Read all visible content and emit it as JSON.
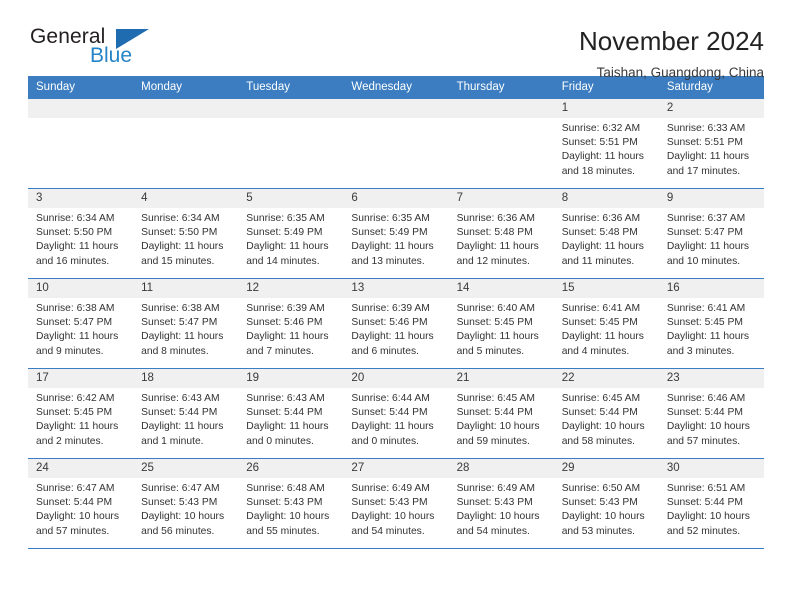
{
  "logo": {
    "word_top": "General",
    "word_bottom": "Blue",
    "triangle_color": "#1f6cb0",
    "blue_text_color": "#2585c7"
  },
  "header": {
    "title": "November 2024",
    "subtitle": "Taishan, Guangdong, China"
  },
  "theme": {
    "header_blue": "#3b7dc0",
    "daynum_band": "#f0f0f0",
    "text": "#333333"
  },
  "calendar": {
    "weekday_headers": [
      "Sunday",
      "Monday",
      "Tuesday",
      "Wednesday",
      "Thursday",
      "Friday",
      "Saturday"
    ],
    "weeks": [
      [
        {
          "day": "",
          "sunrise": "",
          "sunset": "",
          "daylight_l1": "",
          "daylight_l2": "",
          "empty": true
        },
        {
          "day": "",
          "sunrise": "",
          "sunset": "",
          "daylight_l1": "",
          "daylight_l2": "",
          "empty": true
        },
        {
          "day": "",
          "sunrise": "",
          "sunset": "",
          "daylight_l1": "",
          "daylight_l2": "",
          "empty": true
        },
        {
          "day": "",
          "sunrise": "",
          "sunset": "",
          "daylight_l1": "",
          "daylight_l2": "",
          "empty": true
        },
        {
          "day": "",
          "sunrise": "",
          "sunset": "",
          "daylight_l1": "",
          "daylight_l2": "",
          "empty": true
        },
        {
          "day": "1",
          "sunrise": "Sunrise: 6:32 AM",
          "sunset": "Sunset: 5:51 PM",
          "daylight_l1": "Daylight: 11 hours",
          "daylight_l2": "and 18 minutes."
        },
        {
          "day": "2",
          "sunrise": "Sunrise: 6:33 AM",
          "sunset": "Sunset: 5:51 PM",
          "daylight_l1": "Daylight: 11 hours",
          "daylight_l2": "and 17 minutes."
        }
      ],
      [
        {
          "day": "3",
          "sunrise": "Sunrise: 6:34 AM",
          "sunset": "Sunset: 5:50 PM",
          "daylight_l1": "Daylight: 11 hours",
          "daylight_l2": "and 16 minutes."
        },
        {
          "day": "4",
          "sunrise": "Sunrise: 6:34 AM",
          "sunset": "Sunset: 5:50 PM",
          "daylight_l1": "Daylight: 11 hours",
          "daylight_l2": "and 15 minutes."
        },
        {
          "day": "5",
          "sunrise": "Sunrise: 6:35 AM",
          "sunset": "Sunset: 5:49 PM",
          "daylight_l1": "Daylight: 11 hours",
          "daylight_l2": "and 14 minutes."
        },
        {
          "day": "6",
          "sunrise": "Sunrise: 6:35 AM",
          "sunset": "Sunset: 5:49 PM",
          "daylight_l1": "Daylight: 11 hours",
          "daylight_l2": "and 13 minutes."
        },
        {
          "day": "7",
          "sunrise": "Sunrise: 6:36 AM",
          "sunset": "Sunset: 5:48 PM",
          "daylight_l1": "Daylight: 11 hours",
          "daylight_l2": "and 12 minutes."
        },
        {
          "day": "8",
          "sunrise": "Sunrise: 6:36 AM",
          "sunset": "Sunset: 5:48 PM",
          "daylight_l1": "Daylight: 11 hours",
          "daylight_l2": "and 11 minutes."
        },
        {
          "day": "9",
          "sunrise": "Sunrise: 6:37 AM",
          "sunset": "Sunset: 5:47 PM",
          "daylight_l1": "Daylight: 11 hours",
          "daylight_l2": "and 10 minutes."
        }
      ],
      [
        {
          "day": "10",
          "sunrise": "Sunrise: 6:38 AM",
          "sunset": "Sunset: 5:47 PM",
          "daylight_l1": "Daylight: 11 hours",
          "daylight_l2": "and 9 minutes."
        },
        {
          "day": "11",
          "sunrise": "Sunrise: 6:38 AM",
          "sunset": "Sunset: 5:47 PM",
          "daylight_l1": "Daylight: 11 hours",
          "daylight_l2": "and 8 minutes."
        },
        {
          "day": "12",
          "sunrise": "Sunrise: 6:39 AM",
          "sunset": "Sunset: 5:46 PM",
          "daylight_l1": "Daylight: 11 hours",
          "daylight_l2": "and 7 minutes."
        },
        {
          "day": "13",
          "sunrise": "Sunrise: 6:39 AM",
          "sunset": "Sunset: 5:46 PM",
          "daylight_l1": "Daylight: 11 hours",
          "daylight_l2": "and 6 minutes."
        },
        {
          "day": "14",
          "sunrise": "Sunrise: 6:40 AM",
          "sunset": "Sunset: 5:45 PM",
          "daylight_l1": "Daylight: 11 hours",
          "daylight_l2": "and 5 minutes."
        },
        {
          "day": "15",
          "sunrise": "Sunrise: 6:41 AM",
          "sunset": "Sunset: 5:45 PM",
          "daylight_l1": "Daylight: 11 hours",
          "daylight_l2": "and 4 minutes."
        },
        {
          "day": "16",
          "sunrise": "Sunrise: 6:41 AM",
          "sunset": "Sunset: 5:45 PM",
          "daylight_l1": "Daylight: 11 hours",
          "daylight_l2": "and 3 minutes."
        }
      ],
      [
        {
          "day": "17",
          "sunrise": "Sunrise: 6:42 AM",
          "sunset": "Sunset: 5:45 PM",
          "daylight_l1": "Daylight: 11 hours",
          "daylight_l2": "and 2 minutes."
        },
        {
          "day": "18",
          "sunrise": "Sunrise: 6:43 AM",
          "sunset": "Sunset: 5:44 PM",
          "daylight_l1": "Daylight: 11 hours",
          "daylight_l2": "and 1 minute."
        },
        {
          "day": "19",
          "sunrise": "Sunrise: 6:43 AM",
          "sunset": "Sunset: 5:44 PM",
          "daylight_l1": "Daylight: 11 hours",
          "daylight_l2": "and 0 minutes."
        },
        {
          "day": "20",
          "sunrise": "Sunrise: 6:44 AM",
          "sunset": "Sunset: 5:44 PM",
          "daylight_l1": "Daylight: 11 hours",
          "daylight_l2": "and 0 minutes."
        },
        {
          "day": "21",
          "sunrise": "Sunrise: 6:45 AM",
          "sunset": "Sunset: 5:44 PM",
          "daylight_l1": "Daylight: 10 hours",
          "daylight_l2": "and 59 minutes."
        },
        {
          "day": "22",
          "sunrise": "Sunrise: 6:45 AM",
          "sunset": "Sunset: 5:44 PM",
          "daylight_l1": "Daylight: 10 hours",
          "daylight_l2": "and 58 minutes."
        },
        {
          "day": "23",
          "sunrise": "Sunrise: 6:46 AM",
          "sunset": "Sunset: 5:44 PM",
          "daylight_l1": "Daylight: 10 hours",
          "daylight_l2": "and 57 minutes."
        }
      ],
      [
        {
          "day": "24",
          "sunrise": "Sunrise: 6:47 AM",
          "sunset": "Sunset: 5:44 PM",
          "daylight_l1": "Daylight: 10 hours",
          "daylight_l2": "and 57 minutes."
        },
        {
          "day": "25",
          "sunrise": "Sunrise: 6:47 AM",
          "sunset": "Sunset: 5:43 PM",
          "daylight_l1": "Daylight: 10 hours",
          "daylight_l2": "and 56 minutes."
        },
        {
          "day": "26",
          "sunrise": "Sunrise: 6:48 AM",
          "sunset": "Sunset: 5:43 PM",
          "daylight_l1": "Daylight: 10 hours",
          "daylight_l2": "and 55 minutes."
        },
        {
          "day": "27",
          "sunrise": "Sunrise: 6:49 AM",
          "sunset": "Sunset: 5:43 PM",
          "daylight_l1": "Daylight: 10 hours",
          "daylight_l2": "and 54 minutes."
        },
        {
          "day": "28",
          "sunrise": "Sunrise: 6:49 AM",
          "sunset": "Sunset: 5:43 PM",
          "daylight_l1": "Daylight: 10 hours",
          "daylight_l2": "and 54 minutes."
        },
        {
          "day": "29",
          "sunrise": "Sunrise: 6:50 AM",
          "sunset": "Sunset: 5:43 PM",
          "daylight_l1": "Daylight: 10 hours",
          "daylight_l2": "and 53 minutes."
        },
        {
          "day": "30",
          "sunrise": "Sunrise: 6:51 AM",
          "sunset": "Sunset: 5:44 PM",
          "daylight_l1": "Daylight: 10 hours",
          "daylight_l2": "and 52 minutes."
        }
      ]
    ]
  }
}
